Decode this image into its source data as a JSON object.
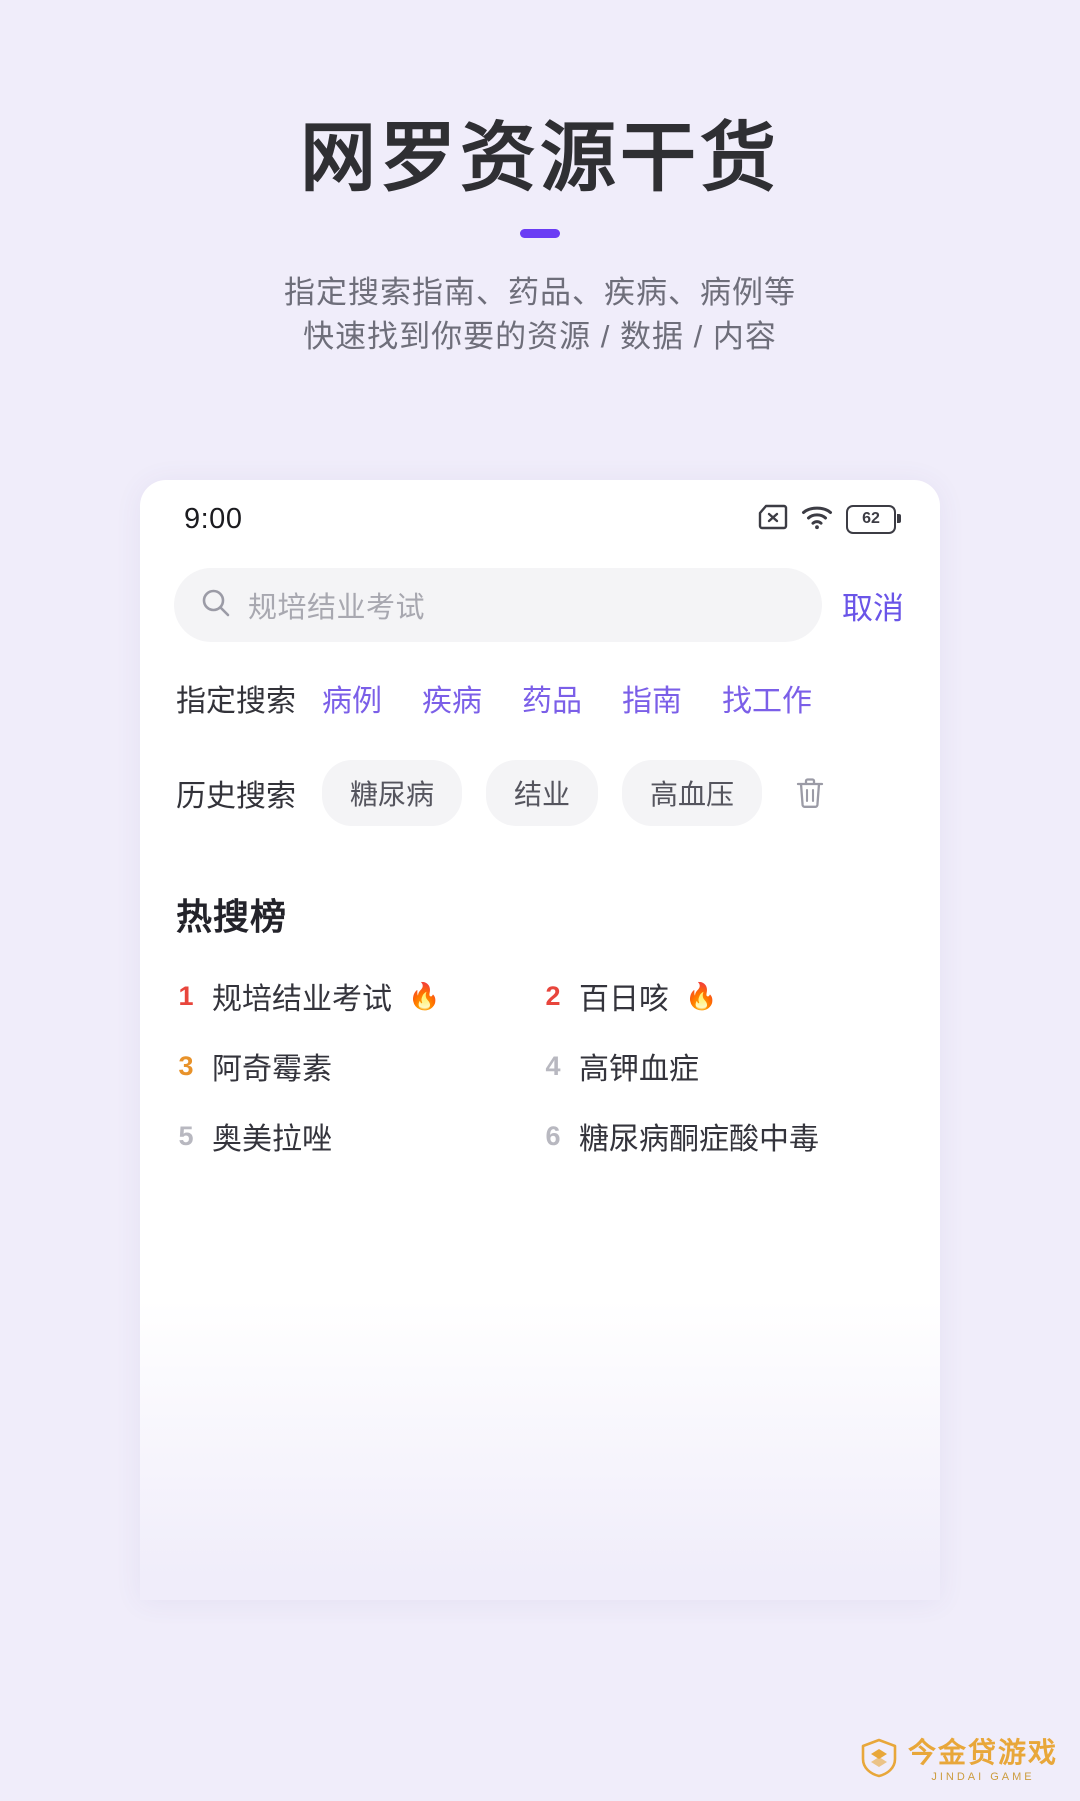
{
  "hero": {
    "title": "网罗资源干货",
    "subtitle_line1": "指定搜索指南、药品、疾病、病例等",
    "subtitle_line2": "快速找到你要的资源 / 数据 / 内容",
    "accent_color": "#6a3cf4"
  },
  "phone": {
    "status": {
      "time": "9:00",
      "sim_icon": "sim-card-off-icon",
      "wifi_icon": "wifi-icon",
      "battery_level": "62"
    },
    "search": {
      "icon": "search-icon",
      "placeholder": "规培结业考试",
      "value": "",
      "cancel_label": "取消"
    },
    "quick_search": {
      "label": "指定搜索",
      "items": [
        {
          "label": "病例"
        },
        {
          "label": "疾病"
        },
        {
          "label": "药品"
        },
        {
          "label": "指南"
        },
        {
          "label": "找工作"
        }
      ],
      "link_color": "#7b5fe8"
    },
    "history": {
      "label": "历史搜索",
      "chips": [
        {
          "label": "糖尿病"
        },
        {
          "label": "结业"
        },
        {
          "label": "高血压"
        }
      ],
      "clear_icon": "trash-icon"
    },
    "hot_list": {
      "title": "热搜榜",
      "items": [
        {
          "rank": "1",
          "text": "规培结业考试",
          "hot": true,
          "rank_color": "#e8453c"
        },
        {
          "rank": "2",
          "text": "百日咳",
          "hot": true,
          "rank_color": "#e8453c"
        },
        {
          "rank": "3",
          "text": "阿奇霉素",
          "hot": false,
          "rank_color": "#e8922a"
        },
        {
          "rank": "4",
          "text": "高钾血症",
          "hot": false,
          "rank_color": "#b8b8c0"
        },
        {
          "rank": "5",
          "text": "奥美拉唑",
          "hot": false,
          "rank_color": "#b8b8c0"
        },
        {
          "rank": "6",
          "text": "糖尿病酮症酸中毒",
          "hot": false,
          "rank_color": "#b8b8c0"
        }
      ],
      "flame_glyph": "🔥"
    }
  },
  "watermark": {
    "main": "今金贷游戏",
    "sub": "JINDAI GAME"
  }
}
